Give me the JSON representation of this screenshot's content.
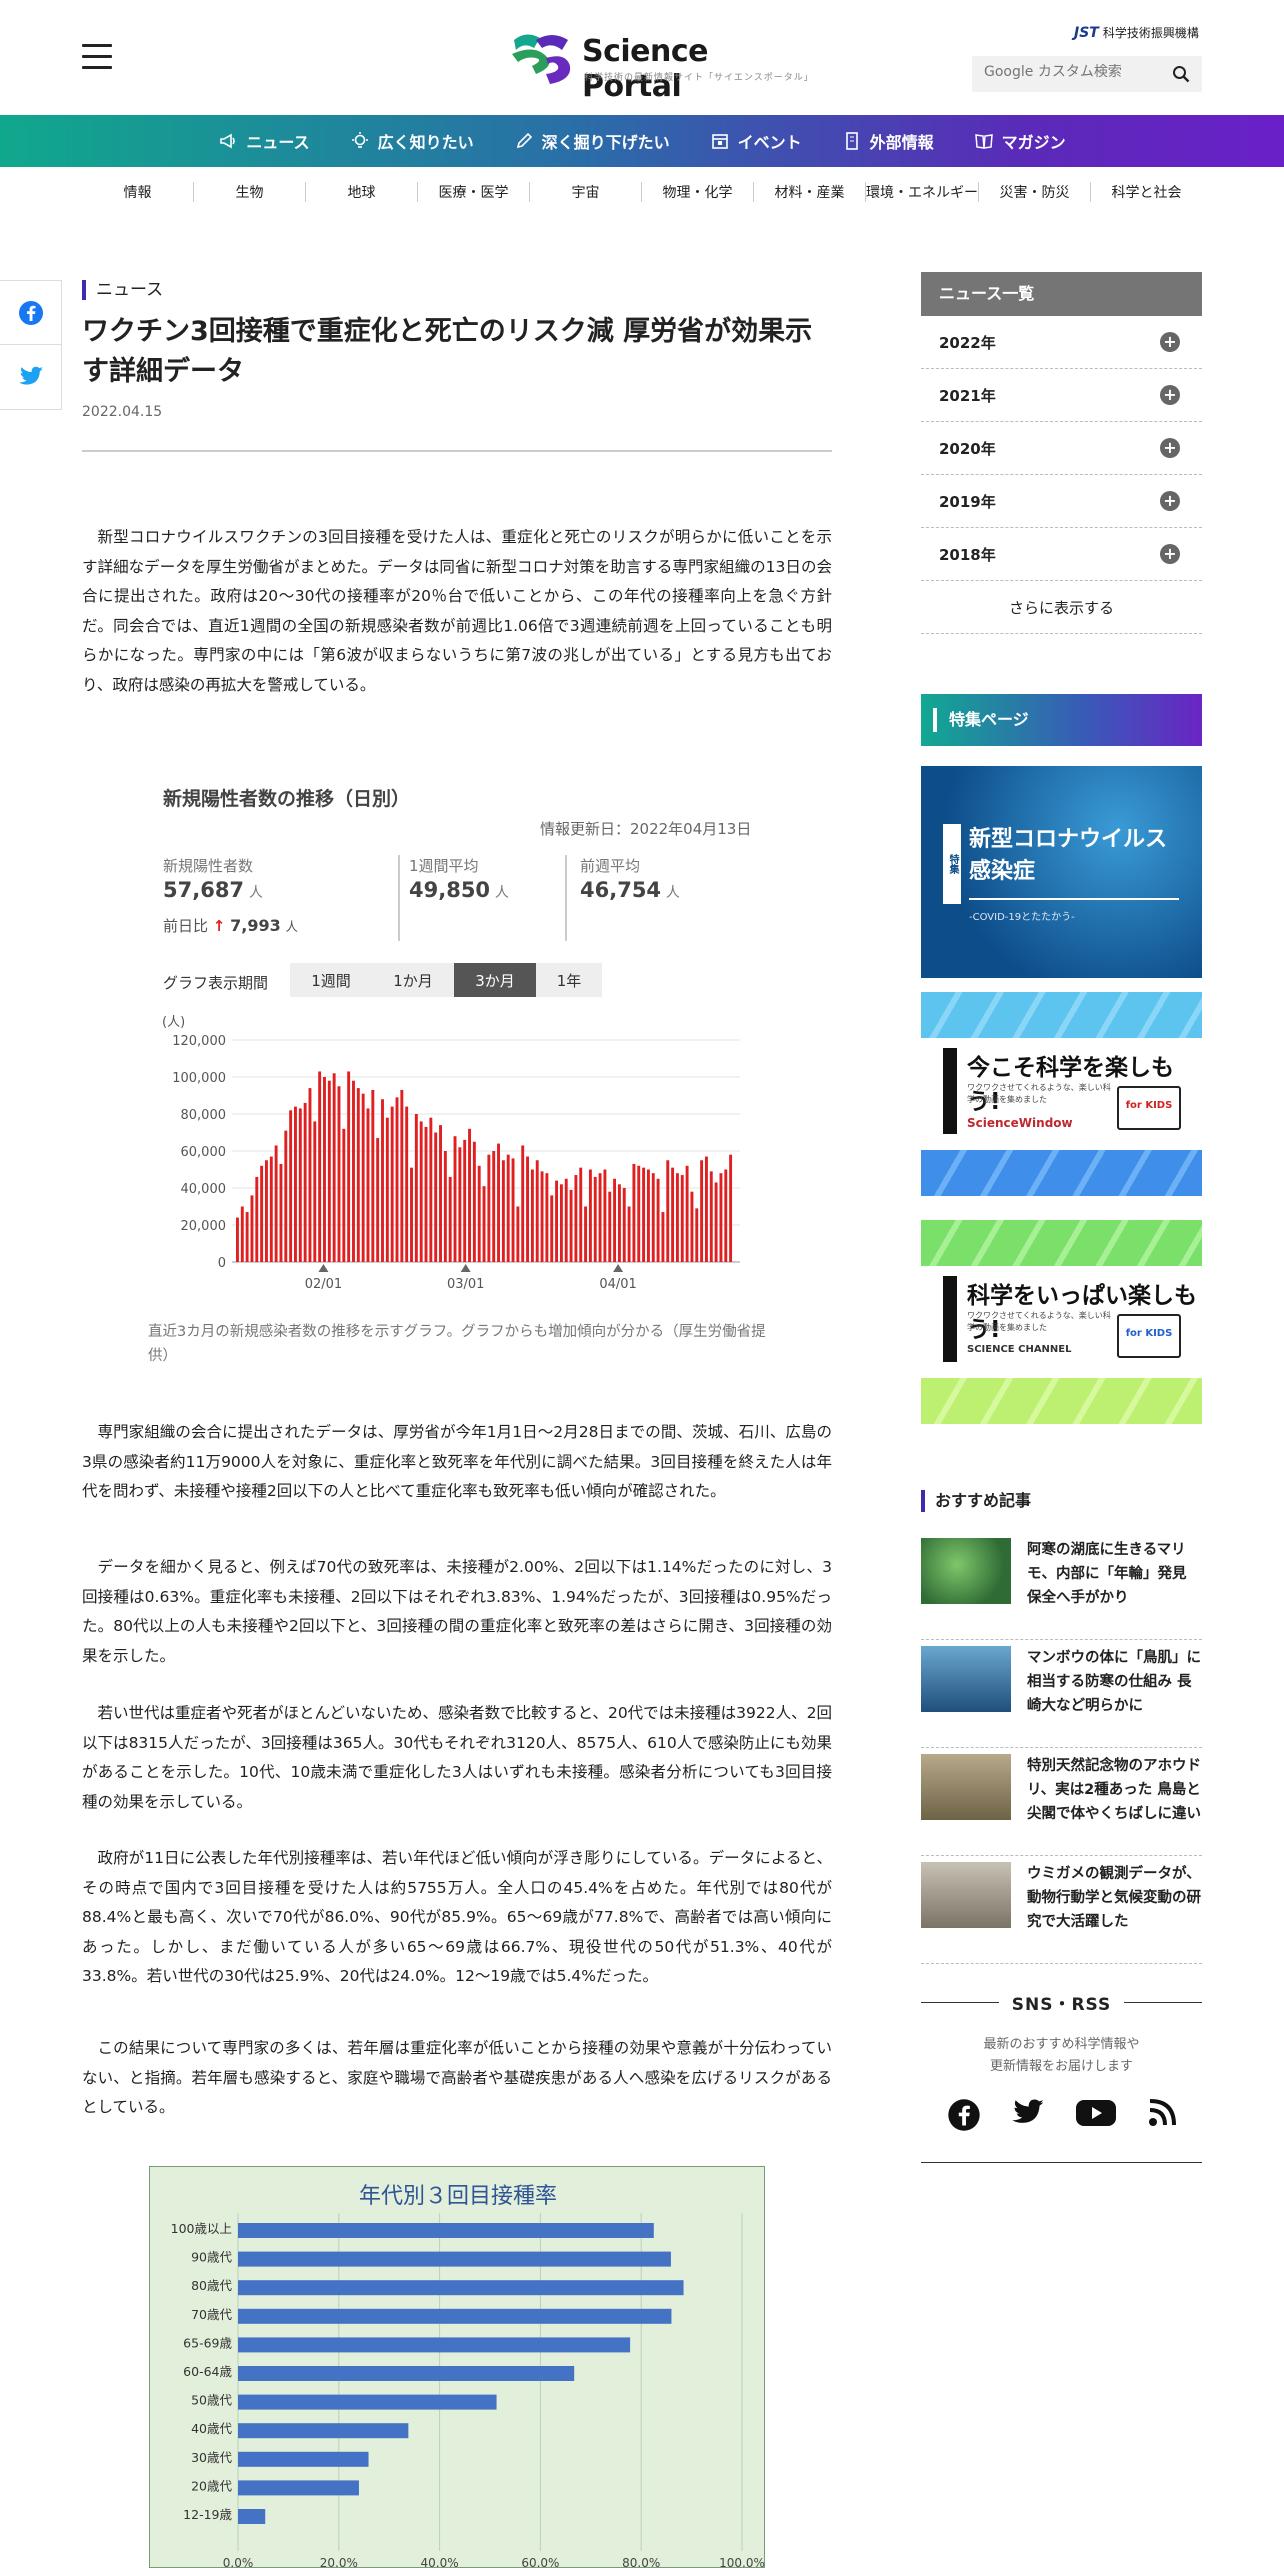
{
  "header": {
    "logo_title": "Science Portal",
    "logo_subtitle": "科学技術の最新情報サイト「サイエンスポータル」",
    "org": "科学技術振興機構",
    "org_mark": "JST",
    "search_placeholder": "Google カスタム検索"
  },
  "nav": [
    {
      "label": "ニュース",
      "icon": "megaphone-icon"
    },
    {
      "label": "広く知りたい",
      "icon": "bulb-icon"
    },
    {
      "label": "深く掘り下げたい",
      "icon": "pen-icon"
    },
    {
      "label": "イベント",
      "icon": "calendar-icon"
    },
    {
      "label": "外部情報",
      "icon": "building-icon"
    },
    {
      "label": "マガジン",
      "icon": "book-icon"
    }
  ],
  "categories": [
    "情報",
    "生物",
    "地球",
    "医療・医学",
    "宇宙",
    "物理・化学",
    "材料・産業",
    "環境・エネルギー",
    "災害・防災",
    "科学と社会"
  ],
  "article": {
    "label": "ニュース",
    "title": "ワクチン3回接種で重症化と死亡のリスク減 厚労省が効果示す詳細データ",
    "date": "2022.04.15",
    "p1": "新型コロナウイルスワクチンの3回目接種を受けた人は、重症化と死亡のリスクが明らかに低いことを示す詳細なデータを厚生労働省がまとめた。データは同省に新型コロナ対策を助言する専門家組織の13日の会合に提出された。政府は20～30代の接種率が20％台で低いことから、この年代の接種率向上を急ぐ方針だ。同会合では、直近1週間の全国の新規感染者数が前週比1.06倍で3週連続前週を上回っていることも明らかになった。専門家の中には「第6波が収まらないうちに第7波の兆しが出ている」とする見方も出ており、政府は感染の再拡大を警戒している。",
    "p2": "専門家組織の会合に提出されたデータは、厚労省が今年1月1日～2月28日までの間、茨城、石川、広島の3県の感染者約11万9000人を対象に、重症化率と致死率を年代別に調べた結果。3回目接種を終えた人は年代を問わず、未接種や接種2回以下の人と比べて重症化率も致死率も低い傾向が確認された。",
    "p3": "データを細かく見ると、例えば70代の致死率は、未接種が2.00%、2回以下は1.14%だったのに対し、3回接種は0.63%。重症化率も未接種、2回以下はそれぞれ3.83%、1.94%だったが、3回接種は0.95%だった。80代以上の人も未接種や2回以下と、3回接種の間の重症化率と致死率の差はさらに開き、3回接種の効果を示した。",
    "p4": "若い世代は重症者や死者がほとんどいないため、感染者数で比較すると、20代では未接種は3922人、2回以下は8315人だったが、3回接種は365人。30代もそれぞれ3120人、8575人、610人で感染防止にも効果があることを示した。10代、10歳未満で重症化した3人はいずれも未接種。感染者分析についても3回目接種の効果を示している。",
    "p5": "政府が11日に公表した年代別接種率は、若い年代ほど低い傾向が浮き彫りにしている。データによると、その時点で国内で3回目接種を受けた人は約5755万人。全人口の45.4%を占めた。年代別では80代が88.4%と最も高く、次いで70代が86.0%、90代が85.9%。65～69歳が77.8%で、高齢者では高い傾向にあった。しかし、まだ働いている人が多い65～69歳は66.7%、現役世代の50代が51.3%、40代が33.8%。若い世代の30代は25.9%、20代は24.0%。12～19歳では5.4%だった。",
    "p6": "この結果について専門家の多くは、若年層は重症化率が低いことから接種の効果や意義が十分伝わっていない、と指摘。若年層も感染すると、家庭や職場で高齢者や基礎疾患がある人へ感染を広げるリスクがあるとしている。",
    "caption": "直近3カ月の新規感染者数の推移を示すグラフ。グラフからも増加傾向が分かる（厚生労働省提供）"
  },
  "chart1_meta": {
    "title": "新規陽性者数の推移（日別）",
    "updated": "情報更新日：2022年04月13日",
    "kpi": [
      {
        "label": "新規陽性者数",
        "value": "57,687",
        "unit": "人"
      },
      {
        "label": "1週間平均",
        "value": "49,850",
        "unit": "人"
      },
      {
        "label": "前週平均",
        "value": "46,754",
        "unit": "人"
      }
    ],
    "day_label": "前日比",
    "day_value": "7,993",
    "day_unit": "人",
    "period_label": "グラフ表示期間",
    "tabs": [
      "1週間",
      "1か月",
      "3か月",
      "1年"
    ],
    "active_tab": "3か月"
  },
  "chart_data": [
    {
      "type": "bar",
      "ylabel": "(人)",
      "ylim": [
        0,
        120000
      ],
      "yticks": [
        "0",
        "20,000",
        "40,000",
        "60,000",
        "80,000",
        "100,000",
        "120,000"
      ],
      "xticks": [
        "02/01",
        "03/01",
        "04/01"
      ],
      "color": "#e02020",
      "values": [
        24000,
        30000,
        27000,
        36000,
        46000,
        52000,
        55000,
        57000,
        63000,
        53000,
        71000,
        82000,
        84000,
        83000,
        86000,
        94000,
        76000,
        103000,
        100000,
        98000,
        102000,
        95000,
        72000,
        103000,
        98000,
        94000,
        91000,
        83000,
        93000,
        67000,
        88000,
        78000,
        84000,
        89000,
        93000,
        84000,
        51000,
        80000,
        76000,
        73000,
        78000,
        70000,
        74000,
        60000,
        46000,
        68000,
        62000,
        66000,
        72000,
        65000,
        52000,
        41000,
        58000,
        60000,
        64000,
        55000,
        58000,
        56000,
        30000,
        63000,
        57000,
        50000,
        55000,
        49000,
        48000,
        36000,
        44000,
        42000,
        45000,
        39000,
        47000,
        51000,
        30000,
        50000,
        46000,
        48000,
        50000,
        38000,
        45000,
        42000,
        40000,
        30000,
        53000,
        52000,
        51000,
        50000,
        48000,
        45000,
        27000,
        55000,
        51000,
        48000,
        47000,
        52000,
        38000,
        29000,
        55000,
        57000,
        49000,
        43000,
        48000,
        50000,
        58000
      ]
    },
    {
      "type": "bar",
      "orientation": "horizontal",
      "title": "年代別３回目接種率",
      "categories": [
        "100歳以上",
        "90歳代",
        "80歳代",
        "70歳代",
        "65-69歳",
        "60-64歳",
        "50歳代",
        "40歳代",
        "30歳代",
        "20歳代",
        "12-19歳"
      ],
      "values": [
        82.5,
        85.9,
        88.4,
        86.0,
        77.8,
        66.7,
        51.3,
        33.8,
        25.9,
        24.0,
        5.4
      ],
      "xlim": [
        0,
        100
      ],
      "xticks": [
        "0.0%",
        "20.0%",
        "40.0%",
        "60.0%",
        "80.0%",
        "100.0%"
      ],
      "color": "#4472c4"
    }
  ],
  "sidebar": {
    "news_head": "ニュース一覧",
    "years": [
      "2022年",
      "2021年",
      "2020年",
      "2019年",
      "2018年"
    ],
    "more": "さらに表示する",
    "feature_head": "特集ページ",
    "banner1_title": "新型コロナウイルス感染症",
    "banner1_tag": "特集",
    "banner1_sub": "-COVID-19とたたかう-",
    "banner2_title": "今こそ科学を楽しもう!",
    "banner2_sub": "ワクワクさせてくれるような、楽しい科学の動画を集めました",
    "banner2_brand": "ScienceWindow",
    "banner3_title": "科学をいっぱい楽しもう!",
    "banner3_sub": "ワクワクさせてくれるような、楽しい科学の動画を集めました",
    "banner3_brand": "SCIENCE CHANNEL",
    "for_kids": "for KIDS",
    "rec_head": "おすすめ記事",
    "rec": [
      "阿寒の湖底に生きるマリモ、内部に「年輪」発見 保全へ手がかり",
      "マンボウの体に「鳥肌」に相当する防寒の仕組み 長崎大など明らかに",
      "特別天然記念物のアホウドリ、実は2種あった 鳥島と尖閣で体やくちばしに違い",
      "ウミガメの観測データが、動物行動学と気候変動の研究で大活躍した"
    ],
    "sns_title": "SNS・RSS",
    "sns_desc1": "最新のおすすめ科学情報や",
    "sns_desc2": "更新情報をお届けします"
  }
}
